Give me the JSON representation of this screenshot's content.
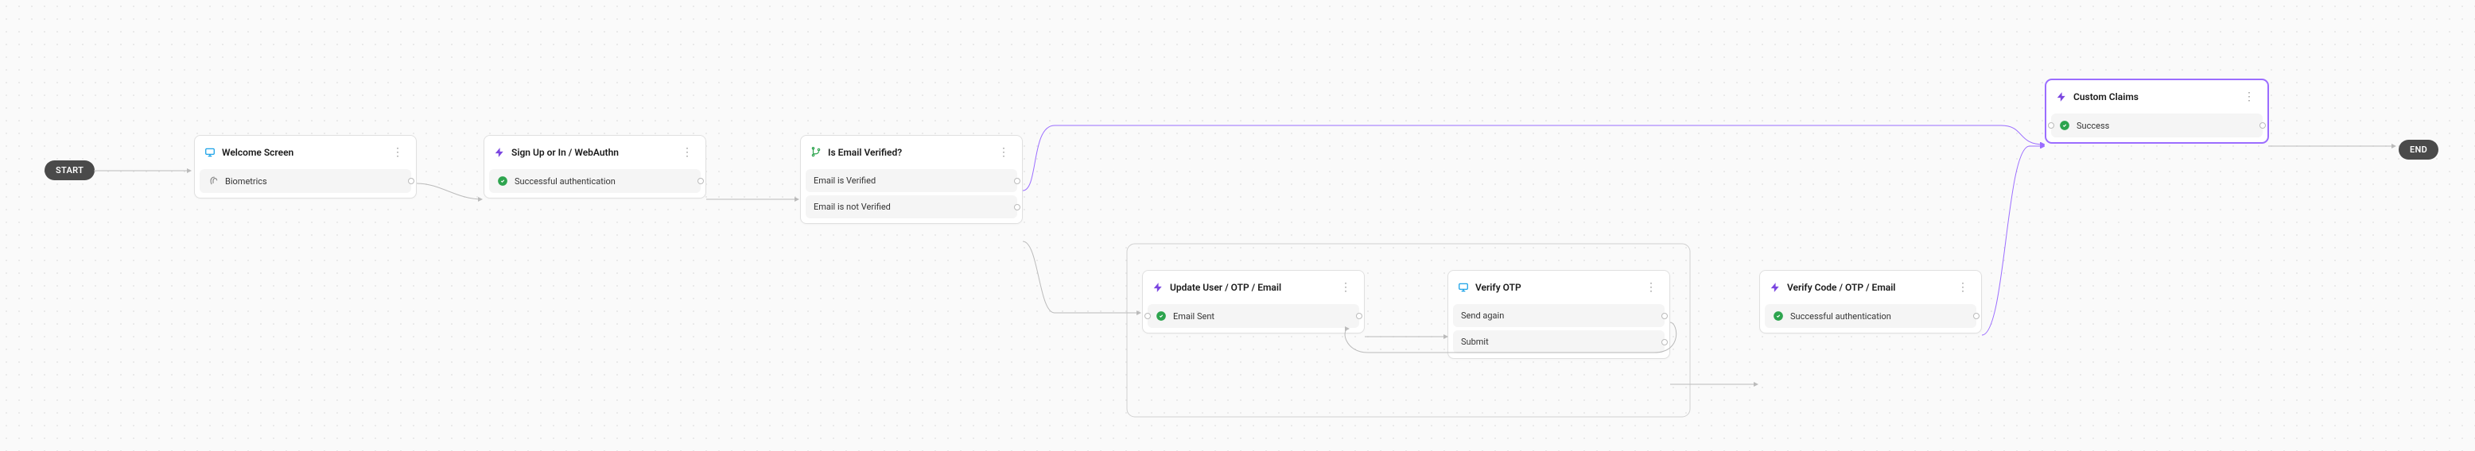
{
  "diagram": {
    "start_label": "START",
    "end_label": "END",
    "nodes": {
      "welcome": {
        "title": "Welcome Screen",
        "outcomes": [
          {
            "label": "Biometrics"
          }
        ]
      },
      "signup": {
        "title": "Sign Up or In / WebAuthn",
        "outcomes": [
          {
            "label": "Successful authentication"
          }
        ]
      },
      "email_verified": {
        "title": "Is Email Verified?",
        "outcomes": [
          {
            "label": "Email is Verified"
          },
          {
            "label": "Email is not Verified"
          }
        ]
      },
      "update_user": {
        "title": "Update User / OTP / Email",
        "outcomes": [
          {
            "label": "Email Sent"
          }
        ]
      },
      "verify_otp": {
        "title": "Verify OTP",
        "outcomes": [
          {
            "label": "Send again"
          },
          {
            "label": "Submit"
          }
        ]
      },
      "verify_code": {
        "title": "Verify Code / OTP / Email",
        "outcomes": [
          {
            "label": "Successful authentication"
          }
        ]
      },
      "custom_claims": {
        "title": "Custom Claims",
        "outcomes": [
          {
            "label": "Success"
          }
        ]
      }
    }
  }
}
